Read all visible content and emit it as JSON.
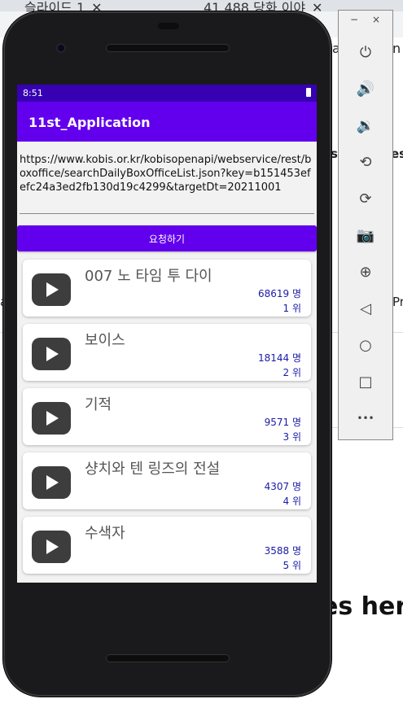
{
  "background": {
    "tab1": "슬라이드 1",
    "tab2": "41,488 당화 이야",
    "text_a": "a",
    "text_n": "n",
    "text_s": "s",
    "text_es": "es",
    "text_pre": "Pre",
    "text_ca": "a",
    "heading_fragment": "es her"
  },
  "status_bar": {
    "time": "8:51"
  },
  "app_bar": {
    "title": "11st_Application"
  },
  "url_field": {
    "value": "https://www.kobis.or.kr/kobisopenapi/webservice/rest/boxoffice/searchDailyBoxOfficeList.json?key=b151453efefc24a3ed2fb130d19c4299&targetDt=20211001"
  },
  "request_button": {
    "label": "요청하기"
  },
  "movies": [
    {
      "title": "007 노 타임 투 다이",
      "audience": "68619 명",
      "rank": "1 위"
    },
    {
      "title": "보이스",
      "audience": "18144 명",
      "rank": "2 위"
    },
    {
      "title": "기적",
      "audience": "9571 명",
      "rank": "3 위"
    },
    {
      "title": "샹치와 텐 링즈의 전설",
      "audience": "4307 명",
      "rank": "4 위"
    },
    {
      "title": "수색자",
      "audience": "3588 명",
      "rank": "5 위"
    }
  ],
  "emulator_toolbar": {
    "minimize": "−",
    "close": "×",
    "buttons": [
      {
        "icon": "power-icon",
        "glyph": "⏻"
      },
      {
        "icon": "volume-up-icon",
        "glyph": "🔊"
      },
      {
        "icon": "volume-down-icon",
        "glyph": "🔉"
      },
      {
        "icon": "rotate-left-icon",
        "glyph": "⟲"
      },
      {
        "icon": "rotate-right-icon",
        "glyph": "⟳"
      },
      {
        "icon": "camera-icon",
        "glyph": "📷"
      },
      {
        "icon": "zoom-icon",
        "glyph": "⊕"
      },
      {
        "icon": "back-icon",
        "glyph": "◁"
      },
      {
        "icon": "home-icon",
        "glyph": "○"
      },
      {
        "icon": "overview-icon",
        "glyph": "□"
      },
      {
        "icon": "more-icon",
        "glyph": "•••"
      }
    ]
  },
  "colors": {
    "status_bar": "#3700b3",
    "primary": "#6200ee",
    "list_text": "#1a1aa8"
  }
}
